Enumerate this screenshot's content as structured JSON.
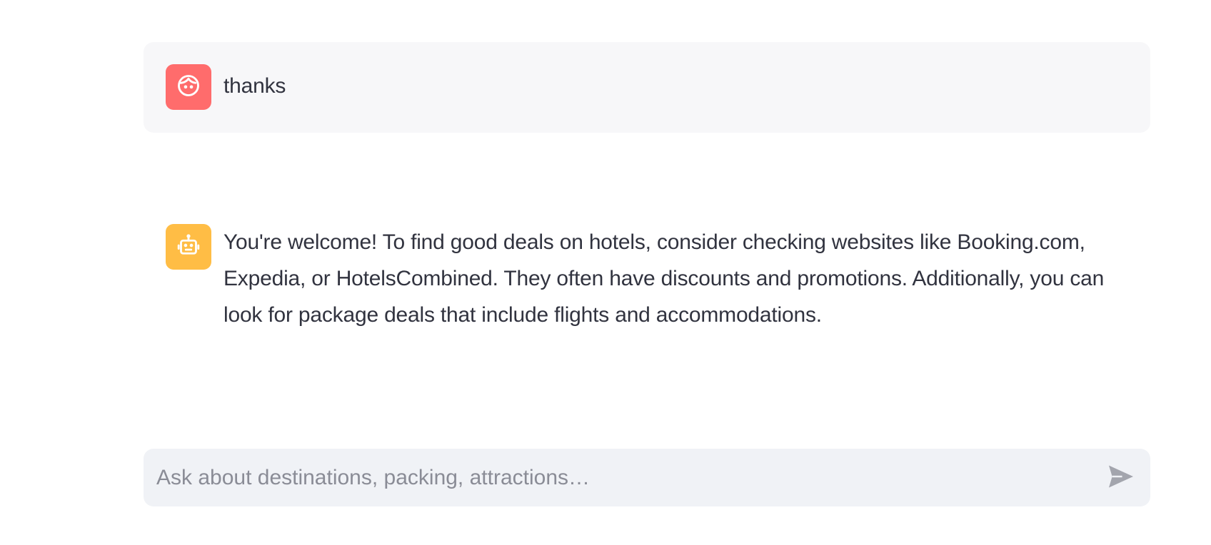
{
  "conversation": {
    "messages": [
      {
        "role": "user",
        "avatar_icon": "face-icon",
        "avatar_color": "#ff6c6c",
        "text": "thanks"
      },
      {
        "role": "assistant",
        "avatar_icon": "robot-icon",
        "avatar_color": "#ffbd45",
        "text": "You're welcome! To find good deals on hotels, consider checking websites like Booking.com, Expedia, or HotelsCombined. They often have discounts and promotions. Additionally, you can look for package deals that include flights and accommodations."
      }
    ]
  },
  "chat_input": {
    "placeholder": "Ask about destinations, packing, attractions…",
    "value": "",
    "send_icon": "send-icon"
  },
  "colors": {
    "user_message_bg": "#f7f7f9",
    "input_bg": "#f0f2f6",
    "text": "#31333f",
    "placeholder": "#8a8c96",
    "send_icon": "#a3a5ad"
  }
}
